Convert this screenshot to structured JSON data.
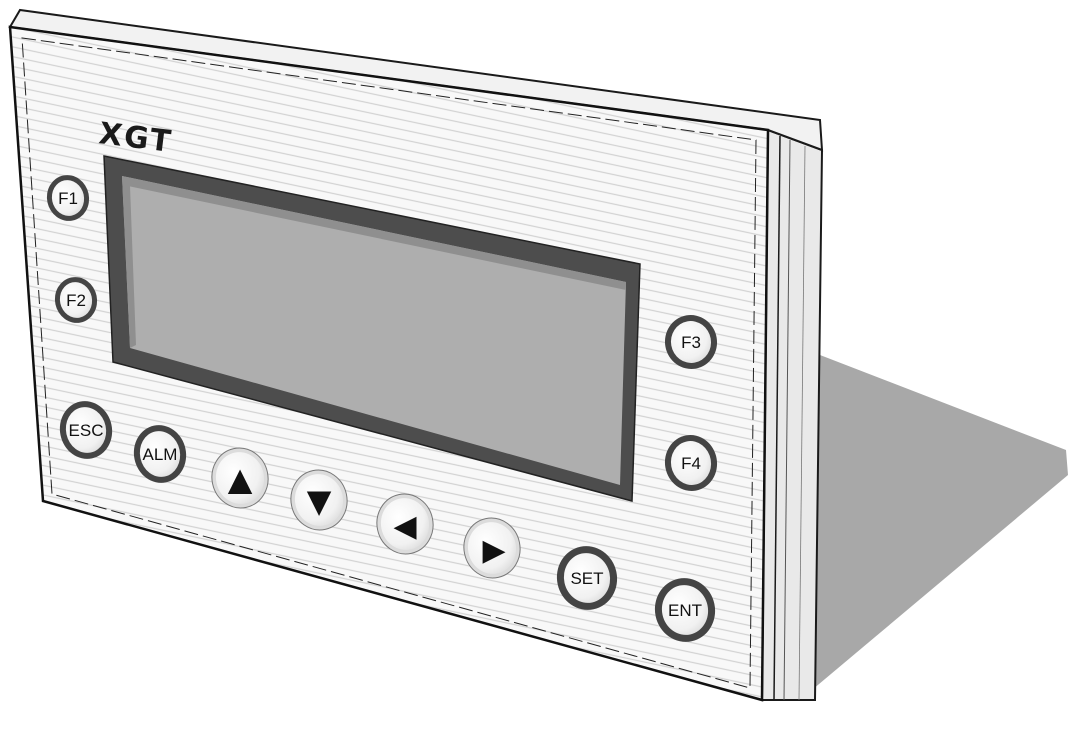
{
  "device": {
    "brand": "XGT",
    "display_text": ""
  },
  "keys": {
    "f1": "F1",
    "f2": "F2",
    "f3": "F3",
    "f4": "F4",
    "esc": "ESC",
    "alm": "ALM",
    "set": "SET",
    "ent": "ENT",
    "up": "▲",
    "down": "▼",
    "left": "◀",
    "right": "▶"
  },
  "colors": {
    "panel": "#f7f7f7",
    "panel_stripe": "#d4d4d4",
    "bezel": "#4d4d4d",
    "lcd": "#aeaeae",
    "side": "#eeeeee",
    "shadow": "#a9a9a9",
    "key_ring": "#4a4a4a",
    "key_face": "#f4f4f4"
  }
}
